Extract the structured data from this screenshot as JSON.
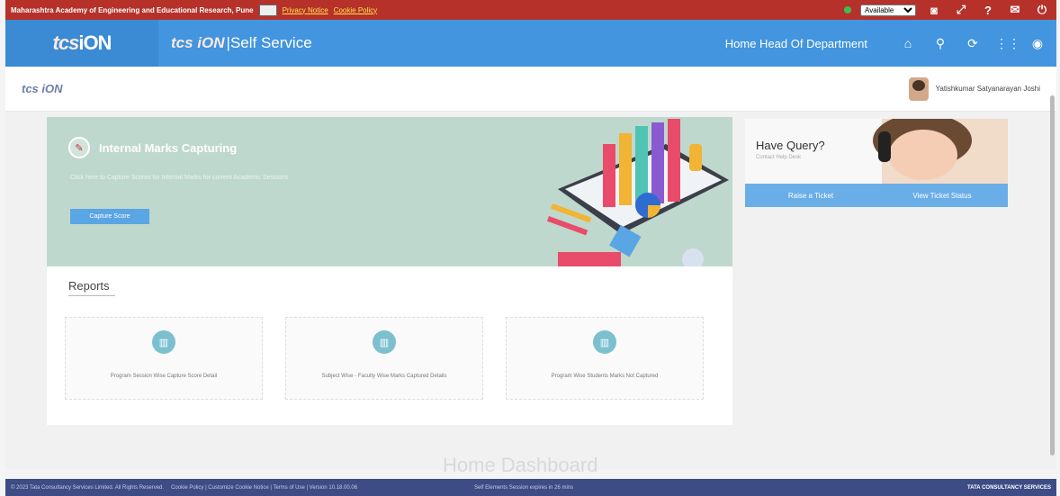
{
  "topbar": {
    "institute": "Maharashtra Academy of Engineering and Educational Research, Pune",
    "privacy": "Privacy Notice",
    "cookie": "Cookie Policy",
    "status": "Available",
    "colors": {
      "bar": "#b5312a",
      "link": "#ffe34d"
    }
  },
  "header": {
    "brand_tcs": "tcs",
    "brand_ion": "iON",
    "self_service": "Self Service",
    "home": "Home Head Of Department",
    "icons": [
      "home-icon",
      "search-icon",
      "refresh-icon",
      "apps-icon",
      "user-circle-icon"
    ],
    "color": "#4295de"
  },
  "subheader": {
    "logo": "tcs iON",
    "user_name": "Yatishkumar Satyanarayan Joshi"
  },
  "banner": {
    "title": "Internal Marks Capturing",
    "description": "Click here to Capture Scores for Internal Marks for current Academic Sessions",
    "button": "Capture Score"
  },
  "reports": {
    "heading": "Reports",
    "cards": [
      {
        "label": "Program Session Wise Capture Score Detail"
      },
      {
        "label": "Subject Wise - Faculty Wise Marks Captured Details"
      },
      {
        "label": "Program Wise Students Marks Not Captured"
      }
    ]
  },
  "query": {
    "title": "Have Query?",
    "subtitle": "Contact Help Desk",
    "raise": "Raise a Ticket",
    "view": "View Ticket Status"
  },
  "footer": {
    "copyright": "© 2023 Tata Consultancy Services Limited. All Rights Reserved.",
    "links": "Cookie Policy | Customize Cookie Notice | Terms of Use | Version 10.18.00.06",
    "session": "Self Elements Session expires in 26 mins",
    "company": "TATA CONSULTANCY SERVICES"
  },
  "ghost_text": "Home Dashboard"
}
